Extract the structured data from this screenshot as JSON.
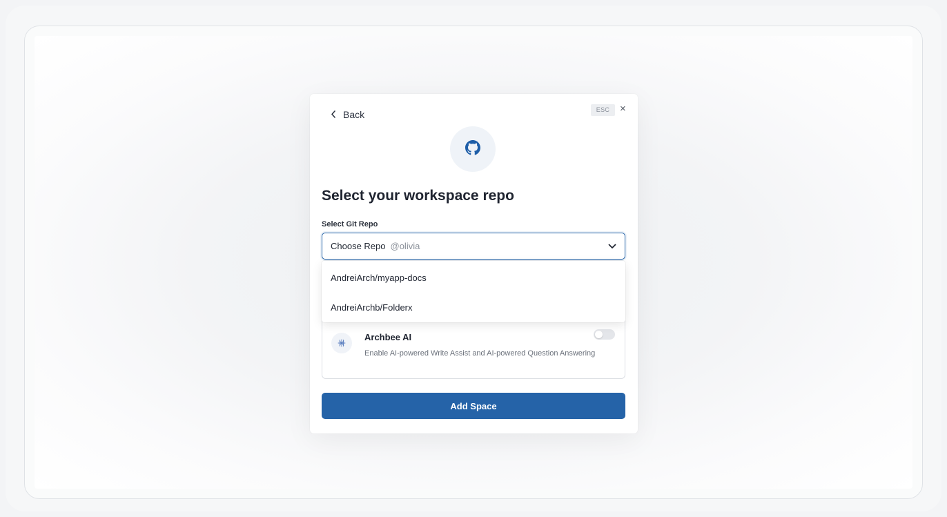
{
  "modal": {
    "back_label": "Back",
    "esc_label": "ESC",
    "close_symbol": "×",
    "header_icon": "github-icon",
    "title": "Select your workspace repo",
    "repo_field": {
      "label": "Select Git Repo",
      "value": "Choose Repo",
      "owner": "@olivia"
    },
    "repo_options": [
      {
        "label": "AndreiArch/myapp-docs"
      },
      {
        "label": "AndreiArchb/Folderx"
      }
    ],
    "ai_card": {
      "icon": "sparkle-icon",
      "title": "Archbee AI",
      "description": "Enable AI-powered Write Assist and AI-powered Question Answering",
      "enabled": false
    },
    "submit_label": "Add Space"
  },
  "colors": {
    "accent": "#2563a8",
    "background": "#f3f4f6",
    "toggle_off": "#e4e6ea"
  }
}
